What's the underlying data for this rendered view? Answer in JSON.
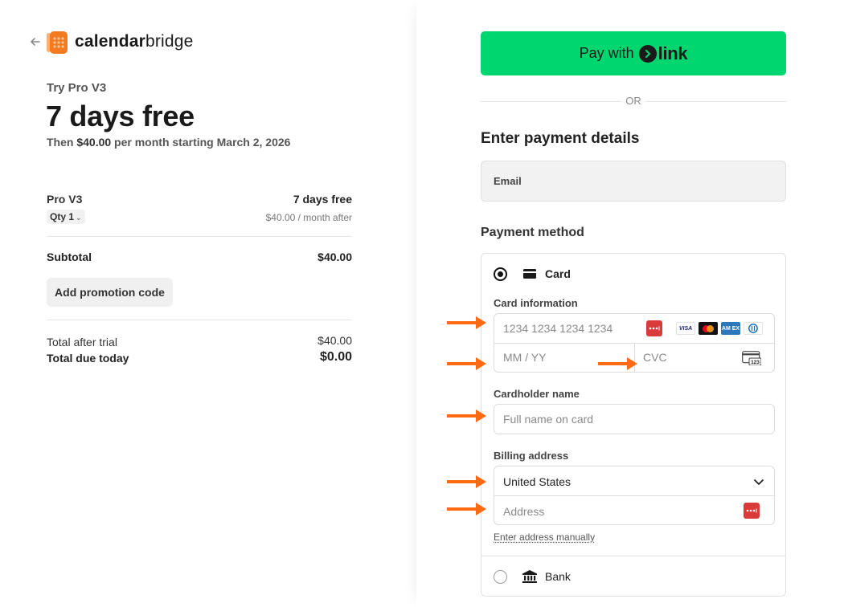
{
  "brand": {
    "name_bold": "calendar",
    "name_regular": "bridge"
  },
  "plan": {
    "try_label": "Try Pro V3",
    "headline": "7 days free",
    "then_prefix": "Then ",
    "then_amount": "$40.00",
    "then_suffix": " per month starting March 2, 2026"
  },
  "line_item": {
    "name": "Pro V3",
    "qty": "Qty 1",
    "price": "7 days free",
    "price_after": "$40.00 / month after"
  },
  "summary": {
    "subtotal_label": "Subtotal",
    "subtotal_value": "$40.00",
    "promo_label": "Add promotion code",
    "after_trial_label": "Total after trial",
    "after_trial_value": "$40.00",
    "due_today_label": "Total due today",
    "due_today_value": "$0.00"
  },
  "link_button": {
    "pay_with": "Pay with",
    "link_word": "link"
  },
  "or_text": "OR",
  "payment": {
    "title": "Enter payment details",
    "email_placeholder": "Email",
    "method_title": "Payment method",
    "card_label": "Card",
    "card_info_label": "Card information",
    "card_number_placeholder": "1234 1234 1234 1234",
    "expiry_placeholder": "MM / YY",
    "cvc_placeholder": "CVC",
    "cvc_icon_text": "123",
    "cardholder_label": "Cardholder name",
    "cardholder_placeholder": "Full name on card",
    "billing_label": "Billing address",
    "country_value": "United States",
    "address_placeholder": "Address",
    "manual_link": "Enter address manually",
    "bank_label": "Bank",
    "card_brands": [
      "VISA",
      "Mastercard",
      "American Express",
      "Diners Club"
    ],
    "card_brand_visa_text": "VISA",
    "card_brand_amex_text": "AM EX"
  },
  "colors": {
    "link_green": "#00d66f",
    "annotation_arrow": "#ff6a13",
    "password_manager": "#d93a3a"
  },
  "icons": {
    "back": "arrow-left-icon",
    "logo": "calendarbridge-logo-icon",
    "card": "credit-card-icon",
    "bank": "bank-icon",
    "chevron": "chevron-down-icon",
    "password_manager": "password-manager-icon",
    "cvc": "cvc-card-icon"
  }
}
